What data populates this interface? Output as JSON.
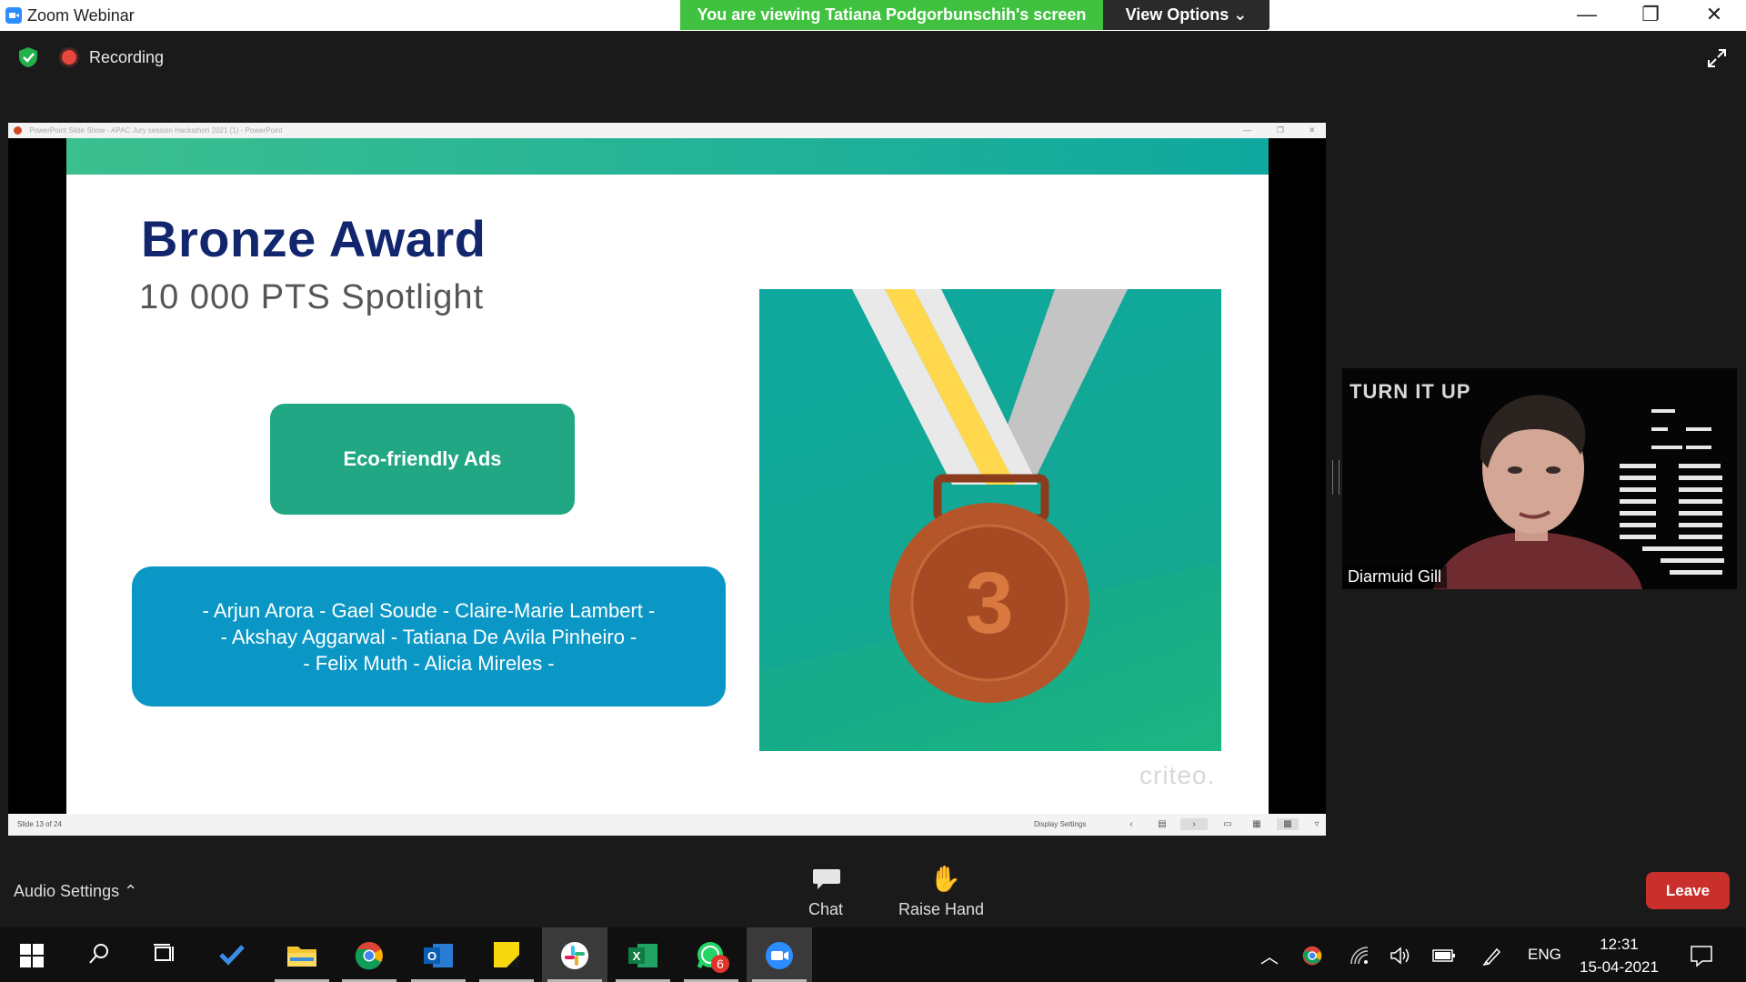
{
  "window": {
    "title": "Zoom Webinar",
    "minimize": "—",
    "maximize": "❐",
    "close": "✕"
  },
  "banner": {
    "viewing": "You are viewing Tatiana Podgorbunschih's screen",
    "view_options": "View Options ⌄"
  },
  "meeting": {
    "recording": "Recording"
  },
  "powerpoint": {
    "titlebar": "PowerPoint Slide Show  -  APAC Jury session Hackathon 2021 (1)  -  PowerPoint",
    "status_slide": "Slide 13 of 24",
    "display_settings": "Display Settings"
  },
  "slide": {
    "title": "Bronze Award",
    "subtitle": "10 000  PTS  Spotlight",
    "project": "Eco-friendly Ads",
    "names": [
      "- Arjun Arora - Gael Soude - Claire-Marie Lambert -",
      "- Akshay Aggarwal - Tatiana De Avila Pinheiro -",
      "- Felix Muth - Alicia Mireles -"
    ],
    "medal_number": "3",
    "brand": "criteo."
  },
  "video": {
    "participant": "Diarmuid Gill",
    "background_text": "TURN IT UP"
  },
  "controls": {
    "audio_settings": "Audio Settings  ⌃",
    "chat": "Chat",
    "raise_hand": "Raise Hand",
    "leave": "Leave"
  },
  "taskbar": {
    "whatsapp_badge": "6",
    "language": "ENG",
    "time": "12:31",
    "date": "15-04-2021"
  },
  "colors": {
    "zoom_blue": "#2d8cff",
    "banner_green": "#40c240",
    "leave_red": "#c9302c",
    "slide_navy": "#12266e",
    "eco_green": "#21a783",
    "names_blue": "#0a97c5",
    "medal_teal": "#0ea89e",
    "bronze": "#b5562a"
  }
}
